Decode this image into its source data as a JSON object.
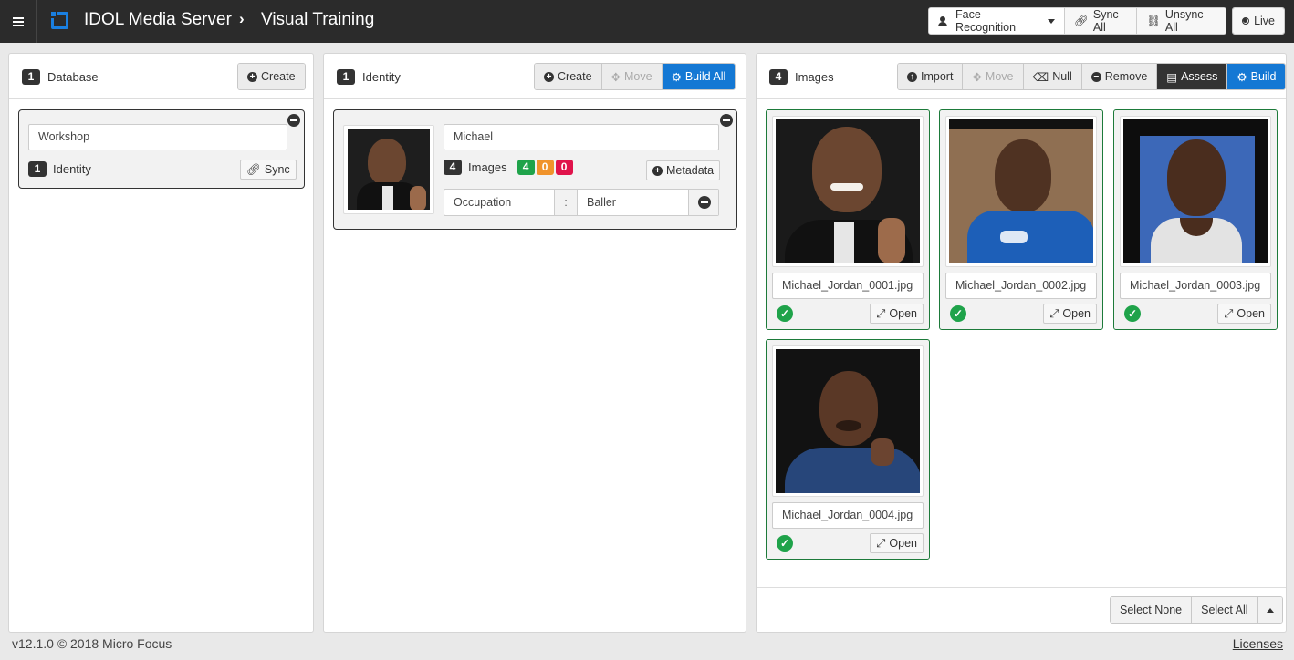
{
  "app": {
    "title": "IDOL Media Server",
    "page": "Visual Training"
  },
  "topbar": {
    "recognition_select": "Face Recognition",
    "sync_all": "Sync All",
    "unsync_all": "Unsync All",
    "live": "Live"
  },
  "database_panel": {
    "count": "1",
    "title": "Database",
    "create": "Create",
    "item": {
      "name": "Workshop",
      "identity_count": "1",
      "identity_label": "Identity",
      "sync": "Sync"
    }
  },
  "identity_panel": {
    "count": "1",
    "title": "Identity",
    "create": "Create",
    "move": "Move",
    "build_all": "Build All",
    "item": {
      "name": "Michael",
      "images_count": "4",
      "images_label": "Images",
      "status_green": "4",
      "status_orange": "0",
      "status_red": "0",
      "metadata": "Metadata",
      "meta_key": "Occupation",
      "meta_sep": ":",
      "meta_value": "Baller"
    }
  },
  "images_panel": {
    "count": "4",
    "title": "Images",
    "import": "Import",
    "move": "Move",
    "null": "Null",
    "remove": "Remove",
    "assess": "Assess",
    "build": "Build",
    "open_label": "Open",
    "images": [
      {
        "filename": "Michael_Jordan_0001.jpg"
      },
      {
        "filename": "Michael_Jordan_0002.jpg"
      },
      {
        "filename": "Michael_Jordan_0003.jpg"
      },
      {
        "filename": "Michael_Jordan_0004.jpg"
      }
    ],
    "select_none": "Select None",
    "select_all": "Select All"
  },
  "footer": {
    "version": "v12.1.0 © 2018 Micro Focus",
    "licenses": "Licenses"
  },
  "colors": {
    "accent": "#1478d4",
    "success": "#1fa34a",
    "warning": "#f0932b",
    "danger": "#e0134b",
    "topbar": "#2b2b2b"
  }
}
